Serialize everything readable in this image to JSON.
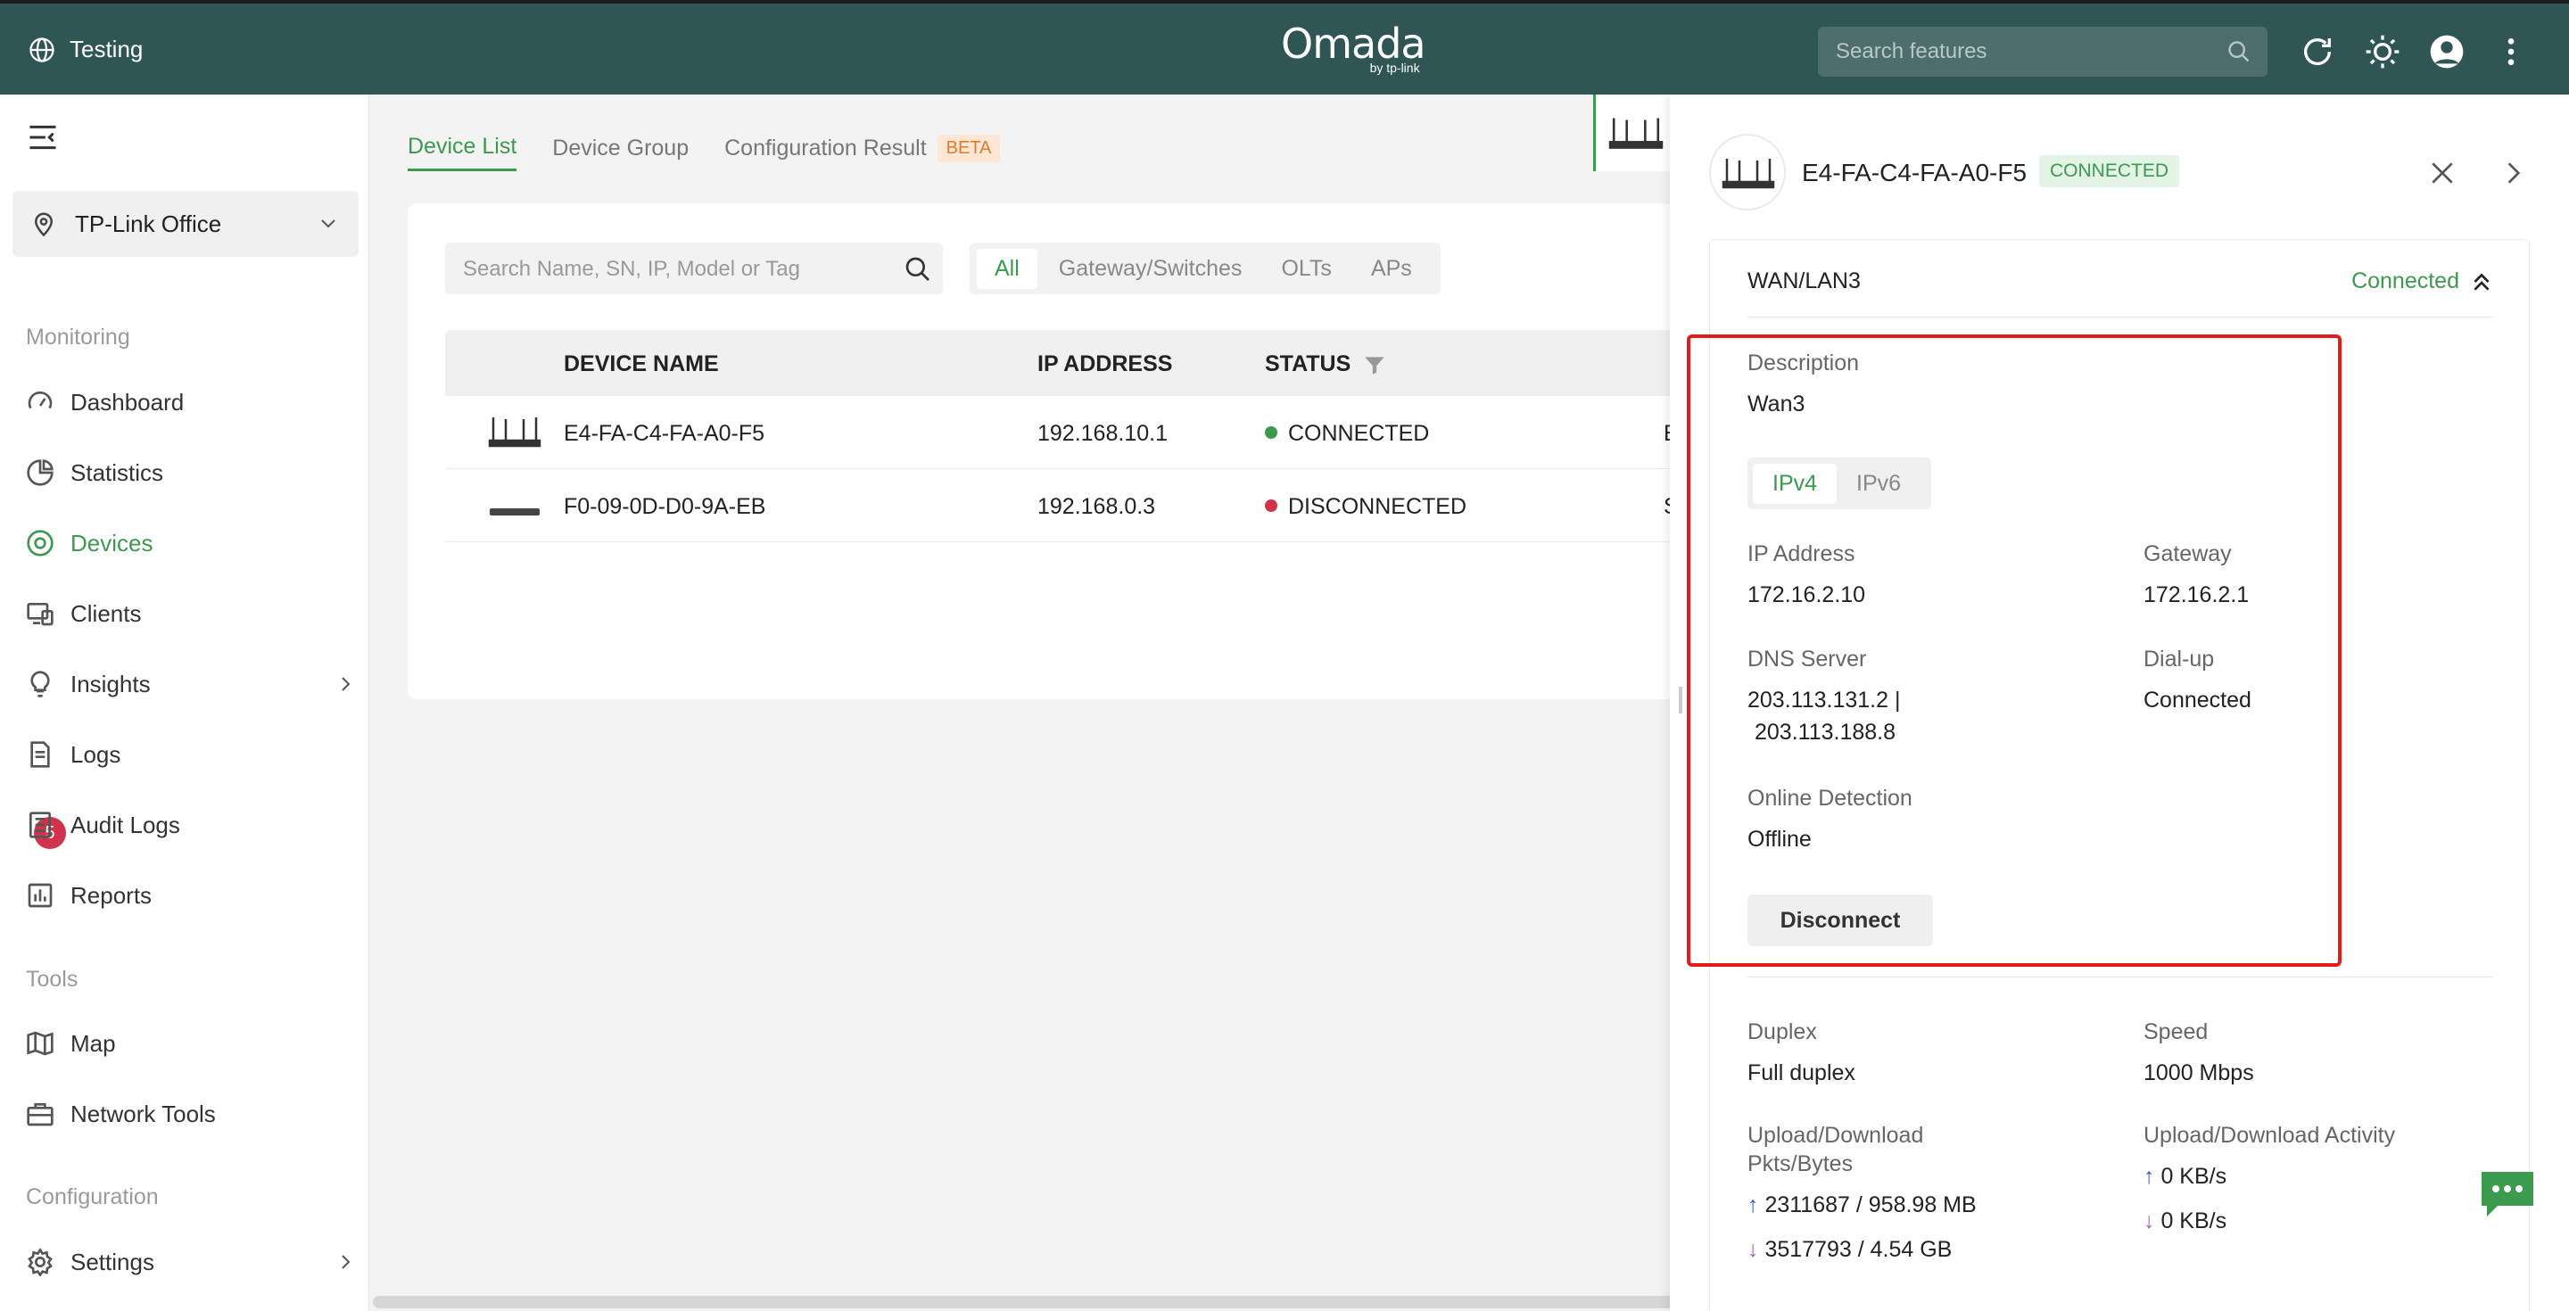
{
  "topbar": {
    "site_name": "Testing",
    "logo": "Omada",
    "logo_sub": "by tp-link",
    "search_placeholder": "Search features",
    "icons": [
      "globe-icon",
      "search-icon",
      "refresh-icon",
      "theme-sun-icon",
      "user-avatar",
      "more-vertical-icon"
    ]
  },
  "sidebar": {
    "site_selector": "TP-Link Office",
    "sections": {
      "monitoring": "Monitoring",
      "tools": "Tools",
      "configuration": "Configuration"
    },
    "items": [
      {
        "label": "Dashboard",
        "icon": "dashboard-icon"
      },
      {
        "label": "Statistics",
        "icon": "pie-chart-icon"
      },
      {
        "label": "Devices",
        "icon": "devices-icon",
        "active": true
      },
      {
        "label": "Clients",
        "icon": "clients-icon"
      },
      {
        "label": "Insights",
        "icon": "lightbulb-icon"
      },
      {
        "label": "Logs",
        "icon": "logs-icon",
        "badge": "5"
      },
      {
        "label": "Audit Logs",
        "icon": "audit-logs-icon"
      },
      {
        "label": "Reports",
        "icon": "reports-icon"
      },
      {
        "label": "Map",
        "icon": "map-icon"
      },
      {
        "label": "Network Tools",
        "icon": "toolbox-icon"
      },
      {
        "label": "Settings",
        "icon": "gear-icon"
      }
    ]
  },
  "main": {
    "tabs": [
      "Device List",
      "Device Group",
      "Configuration Result"
    ],
    "beta_label": "BETA",
    "search_placeholder": "Search Name, SN, IP, Model or Tag",
    "filters": [
      "All",
      "Gateway/Switches",
      "OLTs",
      "APs"
    ],
    "columns": [
      "DEVICE NAME",
      "IP ADDRESS",
      "STATUS"
    ],
    "rows": [
      {
        "name": "E4-FA-C4-FA-A0-F5",
        "ip": "192.168.10.1",
        "status": "CONNECTED",
        "status_color": "#3b9a4e",
        "extra": "E"
      },
      {
        "name": "F0-09-0D-D0-9A-EB",
        "ip": "192.168.0.3",
        "status": "DISCONNECTED",
        "status_color": "#d0334b",
        "extra": "S"
      }
    ]
  },
  "drawer": {
    "device_name": "E4-FA-C4-FA-A0-F5",
    "status": "CONNECTED",
    "port": {
      "title": "WAN/LAN3",
      "state": "Connected",
      "description_label": "Description",
      "description": "Wan3",
      "ip_tabs": [
        "IPv4",
        "IPv6"
      ],
      "ip_address_label": "IP Address",
      "ip_address": "172.16.2.10",
      "gateway_label": "Gateway",
      "gateway": "172.16.2.1",
      "dns_label": "DNS Server",
      "dns_line1": "203.113.131.2 |",
      "dns_line2": "203.113.188.8",
      "dialup_label": "Dial-up",
      "dialup": "Connected",
      "online_detection_label": "Online Detection",
      "online_detection": "Offline",
      "disconnect_button": "Disconnect",
      "duplex_label": "Duplex",
      "duplex": "Full duplex",
      "speed_label": "Speed",
      "speed": "1000 Mbps",
      "pkts_label_1": "Upload/Download",
      "pkts_label_2": "Pkts/Bytes",
      "upload_pkts": "2311687 / 958.98 MB",
      "download_pkts": "3517793 / 4.54 GB",
      "activity_label": "Upload/Download Activity",
      "upload_rate": "0 KB/s",
      "download_rate": "0 KB/s"
    }
  },
  "colors": {
    "header": "#2f5655",
    "accent": "#3b9a4e",
    "danger": "#d0334b",
    "highlight_box": "#e51b1b"
  }
}
